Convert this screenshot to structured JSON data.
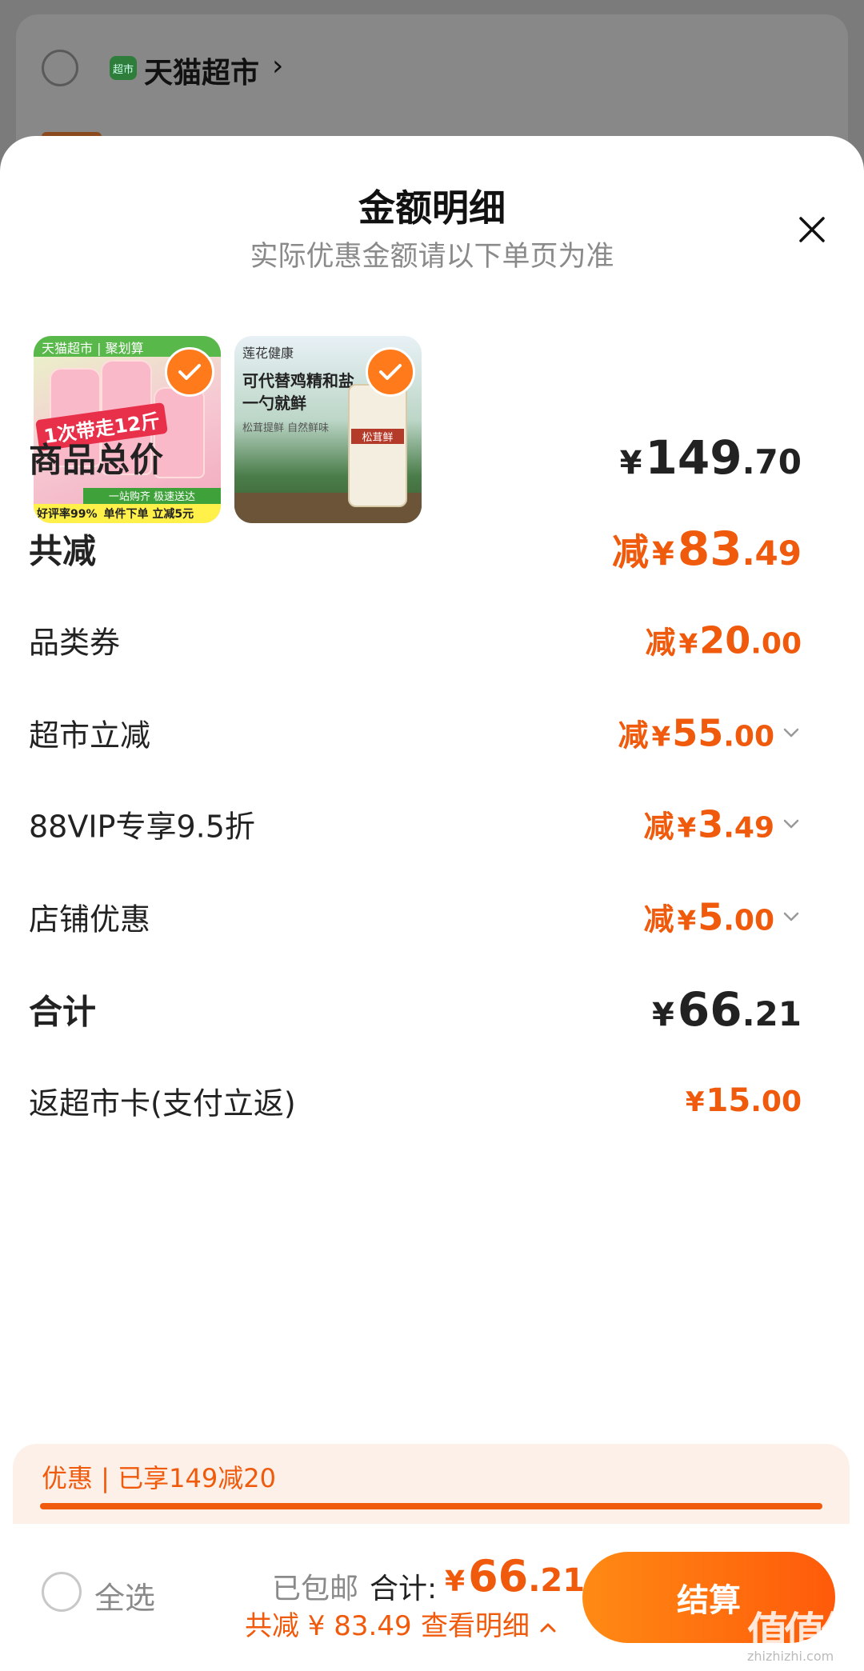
{
  "background": {
    "store_name": "天猫超市",
    "store_chevron": "›",
    "store_icon_text": "超市"
  },
  "sheet": {
    "title": "金额明细",
    "subtitle": "实际优惠金额请以下单页为准",
    "close_icon": "close-icon"
  },
  "products": [
    {
      "name": "product-thumbnail-detergent",
      "selected": true,
      "band_text": "天猫超市 | 聚划算",
      "badge_text": "1次带走12斤",
      "strip_text": "一站购齐 极速送达",
      "bottom_left": "好评率99%",
      "bottom_right": "单件下单 立减5元"
    },
    {
      "name": "product-thumbnail-seasoning",
      "selected": true,
      "brand": "莲花健康",
      "line1": "可代替鸡精和盐",
      "line2": "一勺就鲜",
      "line3": "松茸提鲜 自然鲜味",
      "jar_label": "松茸鲜"
    }
  ],
  "breakdown": {
    "total_goods": {
      "label": "商品总价",
      "yen": "¥",
      "int": "149",
      "dec": ".70"
    },
    "total_discount": {
      "label": "共减",
      "prefix": "减",
      "yen": "¥",
      "int": "83",
      "dec": ".49"
    },
    "items": [
      {
        "label": "品类券",
        "prefix": "减",
        "yen": "¥",
        "int": "20",
        "dec": ".00",
        "has_chevron": false
      },
      {
        "label": "超市立减",
        "prefix": "减",
        "yen": "¥",
        "int": "55",
        "dec": ".00",
        "has_chevron": true
      },
      {
        "label": "88VIP专享9.5折",
        "prefix": "减",
        "yen": "¥",
        "int": "3",
        "dec": ".49",
        "has_chevron": true
      },
      {
        "label": "店铺优惠",
        "prefix": "减",
        "yen": "¥",
        "int": "5",
        "dec": ".00",
        "has_chevron": true
      }
    ],
    "subtotal": {
      "label": "合计",
      "yen": "¥",
      "int": "66",
      "dec": ".21"
    },
    "cashback": {
      "label": "返超市卡(支付立返)",
      "yen": "¥",
      "int": "15",
      "dec": ".00"
    }
  },
  "promo": {
    "text": "优惠 | 已享149减20",
    "progress": 1.0
  },
  "footer": {
    "select_all": "全选",
    "shipping": "已包邮",
    "total_label": "合计:",
    "total_yen": "¥",
    "total_int": "66",
    "total_dec": ".21",
    "saved_text": "共减 ¥ 83.49",
    "detail_link": "查看明细",
    "checkout": "结算",
    "watermark": "值值值",
    "watermark_url": "zhizhizhi.com"
  },
  "colors": {
    "accent": "#f05a0c",
    "checkout_gradient_start": "#ff8a14",
    "checkout_gradient_end": "#ff5a0a",
    "text": "#222222",
    "muted": "#8a8a8a"
  }
}
